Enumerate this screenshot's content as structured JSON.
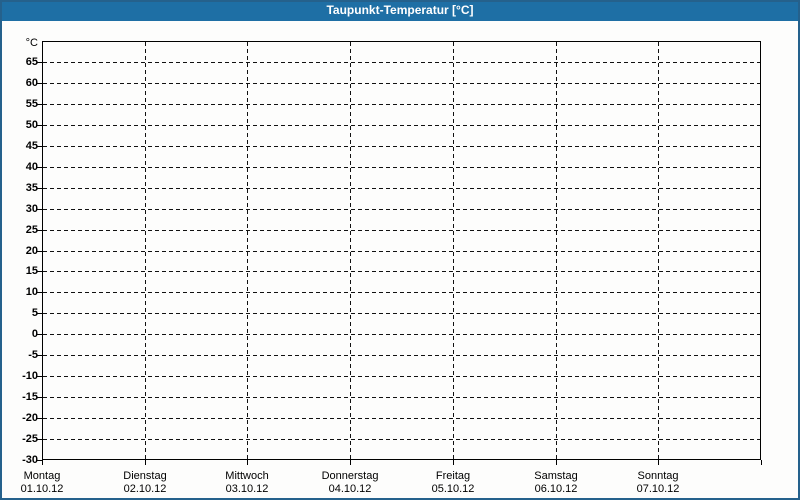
{
  "window": {
    "title": "Taupunkt-Temperatur [°C]"
  },
  "colors": {
    "titlebar_bg": "#1e6fa5",
    "title_text": "#ffffff",
    "frame_border": "#25618c",
    "window_bg": "#fdfdfc",
    "axis": "#000000",
    "grid": "#111111"
  },
  "chart_data": {
    "type": "line",
    "title": "Taupunkt-Temperatur [°C]",
    "ylabel": "°C",
    "xlabel": "",
    "ylim": [
      -30,
      70
    ],
    "ytick_step": 5,
    "ytick_labels": [
      65,
      60,
      55,
      50,
      45,
      40,
      35,
      30,
      25,
      20,
      15,
      10,
      5,
      0,
      -5,
      -10,
      -15,
      -20,
      -25,
      -30
    ],
    "grid": "dashed",
    "legend": "none",
    "days": [
      {
        "label": "Montag",
        "date": "01.10.12"
      },
      {
        "label": "Dienstag",
        "date": "02.10.12"
      },
      {
        "label": "Mittwoch",
        "date": "03.10.12"
      },
      {
        "label": "Donnerstag",
        "date": "04.10.12"
      },
      {
        "label": "Freitag",
        "date": "05.10.12"
      },
      {
        "label": "Samstag",
        "date": "06.10.12"
      },
      {
        "label": "Sonntag",
        "date": "07.10.12"
      }
    ],
    "series": []
  }
}
